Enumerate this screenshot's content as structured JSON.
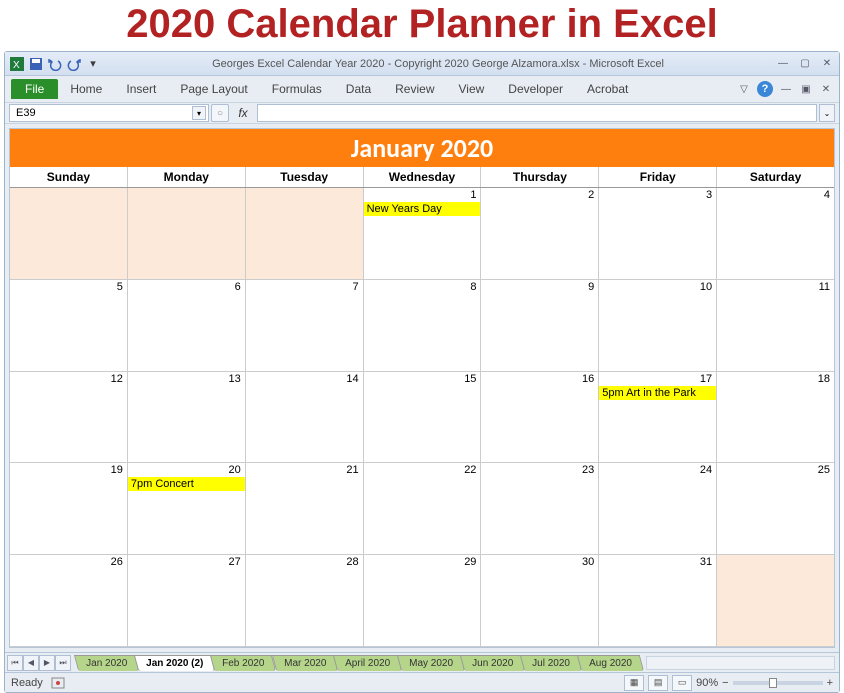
{
  "page_title": "2020 Calendar Planner in Excel",
  "window_title": "Georges Excel Calendar Year 2020 - Copyright 2020 George Alzamora.xlsx - Microsoft Excel",
  "ribbon": {
    "file": "File",
    "tabs": [
      "Home",
      "Insert",
      "Page Layout",
      "Formulas",
      "Data",
      "Review",
      "View",
      "Developer",
      "Acrobat"
    ]
  },
  "name_box": "E39",
  "formula_bar_label": "fx",
  "formula_value": "",
  "calendar": {
    "title": "January 2020",
    "day_headers": [
      "Sunday",
      "Monday",
      "Tuesday",
      "Wednesday",
      "Thursday",
      "Friday",
      "Saturday"
    ],
    "weeks": [
      [
        {
          "pad": true
        },
        {
          "pad": true
        },
        {
          "pad": true
        },
        {
          "num": "1",
          "event": "New Years Day"
        },
        {
          "num": "2"
        },
        {
          "num": "3"
        },
        {
          "num": "4"
        }
      ],
      [
        {
          "num": "5"
        },
        {
          "num": "6"
        },
        {
          "num": "7"
        },
        {
          "num": "8"
        },
        {
          "num": "9"
        },
        {
          "num": "10"
        },
        {
          "num": "11"
        }
      ],
      [
        {
          "num": "12"
        },
        {
          "num": "13"
        },
        {
          "num": "14"
        },
        {
          "num": "15"
        },
        {
          "num": "16"
        },
        {
          "num": "17",
          "event": "5pm Art in the Park"
        },
        {
          "num": "18"
        }
      ],
      [
        {
          "num": "19"
        },
        {
          "num": "20",
          "event": "7pm Concert"
        },
        {
          "num": "21"
        },
        {
          "num": "22"
        },
        {
          "num": "23"
        },
        {
          "num": "24"
        },
        {
          "num": "25"
        }
      ],
      [
        {
          "num": "26"
        },
        {
          "num": "27"
        },
        {
          "num": "28"
        },
        {
          "num": "29"
        },
        {
          "num": "30"
        },
        {
          "num": "31"
        },
        {
          "pad": true
        }
      ]
    ]
  },
  "sheet_tabs": [
    "Jan 2020",
    "Jan 2020 (2)",
    "Feb 2020",
    "Mar 2020",
    "April 2020",
    "May 2020",
    "Jun 2020",
    "Jul 2020",
    "Aug 2020"
  ],
  "active_sheet": 1,
  "status": {
    "ready": "Ready",
    "zoom": "90%"
  }
}
